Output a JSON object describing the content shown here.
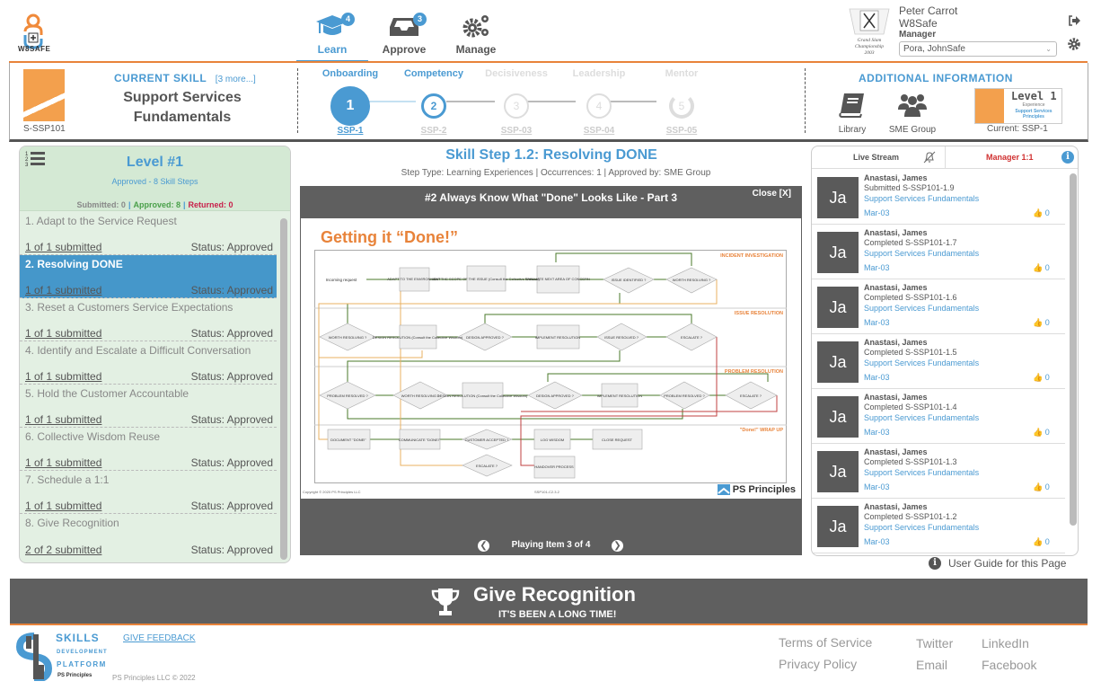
{
  "app": {
    "logo_text": "W8SAFE"
  },
  "nav": {
    "items": [
      {
        "label": "Learn",
        "badge": "4",
        "icon": "graduation-cap-icon",
        "active": true
      },
      {
        "label": "Approve",
        "badge": "3",
        "icon": "inbox-icon",
        "active": false
      },
      {
        "label": "Manage",
        "badge": null,
        "icon": "gears-icon",
        "active": false
      }
    ]
  },
  "user": {
    "name": "Peter Carrot",
    "org": "W8Safe",
    "role_label": "Manager",
    "selected_employee": "Pora, JohnSafe",
    "logo_caption": "Grand Slam Championship 2003"
  },
  "skill": {
    "heading": "CURRENT SKILL",
    "more_link": "[3 more...]",
    "name_line1": "Support Services",
    "name_line2": "Fundamentals",
    "code": "S-SSP101"
  },
  "progression": [
    {
      "title": "Onboarding",
      "number": "1",
      "code": "SSP-1",
      "state": "current"
    },
    {
      "title": "Competency",
      "number": "2",
      "code": "SSP-2",
      "state": "next"
    },
    {
      "title": "Decisiveness",
      "number": "3",
      "code": "SSP-03",
      "state": "locked"
    },
    {
      "title": "Leadership",
      "number": "4",
      "code": "SSP-04",
      "state": "locked"
    },
    {
      "title": "Mentor",
      "number": "5",
      "code": "SSP-05",
      "state": "locked"
    }
  ],
  "additional_info": {
    "title": "ADDITIONAL INFORMATION",
    "library_label": "Library",
    "sme_label": "SME Group",
    "level_card_title": "Level 1",
    "level_card_sub": "Experience",
    "level_card_skill": "Support Services Principles",
    "current_label": "Current:  SSP-1"
  },
  "level": {
    "title": "Level #1",
    "subtitle": "Approved  -  8  Skill  Steps",
    "submitted_label": "Submitted: 0",
    "approved_label": "Approved: 8",
    "returned_label": "Returned: 0",
    "steps": [
      {
        "name": "1. Adapt to the Service Request",
        "submitted": "1 of 1 submitted",
        "status": "Status: Approved",
        "selected": false
      },
      {
        "name": "2. Resolving DONE",
        "submitted": "1 of 1 submitted",
        "status": "Status: Approved",
        "selected": true
      },
      {
        "name": "3. Reset a Customers Service Expectations",
        "submitted": "1 of 1 submitted",
        "status": "Status: Approved",
        "selected": false
      },
      {
        "name": "4. Identify and Escalate a Difficult Conversation",
        "submitted": "1 of 1 submitted",
        "status": "Status: Approved",
        "selected": false
      },
      {
        "name": "5. Hold the Customer Accountable",
        "submitted": "1 of 1 submitted",
        "status": "Status: Approved",
        "selected": false
      },
      {
        "name": "6. Collective Wisdom Reuse",
        "submitted": "1 of 1 submitted",
        "status": "Status: Approved",
        "selected": false
      },
      {
        "name": "7. Schedule a 1:1",
        "submitted": "1 of 1 submitted",
        "status": "Status: Approved",
        "selected": false
      },
      {
        "name": "8. Give Recognition",
        "submitted": "2 of 2 submitted",
        "status": "Status: Approved",
        "selected": false
      }
    ]
  },
  "step_detail": {
    "title": "Skill Step 1.2: Resolving DONE",
    "meta": "Step Type:  Learning Experiences  |  Occurrences:  1  |  Approved by:   SME  Group",
    "player_title": "#2  Always  Know  What  \"Done\"  Looks  Like  -  Part  3",
    "close_label": "Close  [X]",
    "slide_title": "Getting it “Done!”",
    "slide_copyright": "Copyright © 2020 PS Principles LLC",
    "slide_code": "SSP101-C2.3.2",
    "slide_brand": "PS Principles",
    "playing_label": "Playing  Item  3  of  4",
    "flow": {
      "lanes": [
        "INCIDENT INVESTIGATION",
        "ISSUE RESOLUTION",
        "PROBLEM RESOLUTION",
        "\"Done!\" WRAP UP"
      ],
      "start_label": "Incoming request",
      "nodes": {
        "adapt": "ADAPT TO THE ENVIRONMENT",
        "map": "MAP THE SCOPE OF THE ISSUE (Consult the Collective Wisdom)",
        "evaluate": "EVALUATE NEXT AREA OF CONCERN",
        "issue_identified": "ISSUE IDENTIFIED ?",
        "worth_resolving": "WORTH RESOLVING ?",
        "design_resolution": "DESIGN RESOLUTION (Consult the Collective Wisdom)",
        "design_approved": "DESIGN APPROVED ?",
        "implement": "IMPLEMENT RESOLUTION",
        "issue_resolved": "ISSUE RESOLVED ?",
        "escalate": "ESCALATE ?",
        "problem_resolved": "PROBLEM RESOLVED ?",
        "document": "DOCUMENT \"DONE!\"",
        "communicate": "COMMUNICATE \"DONE!\"",
        "customer_accepted": "CUSTOMER ACCEPTED ?",
        "log_wisdom": "LOG WISDOM",
        "close_request": "CLOSE REQUEST",
        "handover": "HANDOVER PROCESS"
      }
    }
  },
  "stream": {
    "tab_live": "Live Stream",
    "tab_manager": "Manager 1:1",
    "items": [
      {
        "initials": "Ja",
        "name": "Anastasi,  James",
        "action": "Submitted  S-SSP101-1.9",
        "skill": "Support  Services  Fundamentals",
        "date": "Mar-03",
        "likes": "0"
      },
      {
        "initials": "Ja",
        "name": "Anastasi,  James",
        "action": "Completed  S-SSP101-1.7",
        "skill": "Support  Services  Fundamentals",
        "date": "Mar-03",
        "likes": "0"
      },
      {
        "initials": "Ja",
        "name": "Anastasi,  James",
        "action": "Completed  S-SSP101-1.6",
        "skill": "Support  Services  Fundamentals",
        "date": "Mar-03",
        "likes": "0"
      },
      {
        "initials": "Ja",
        "name": "Anastasi,  James",
        "action": "Completed  S-SSP101-1.5",
        "skill": "Support  Services  Fundamentals",
        "date": "Mar-03",
        "likes": "0"
      },
      {
        "initials": "Ja",
        "name": "Anastasi,  James",
        "action": "Completed  S-SSP101-1.4",
        "skill": "Support  Services  Fundamentals",
        "date": "Mar-03",
        "likes": "0"
      },
      {
        "initials": "Ja",
        "name": "Anastasi,  James",
        "action": "Completed  S-SSP101-1.3",
        "skill": "Support  Services  Fundamentals",
        "date": "Mar-03",
        "likes": "0"
      },
      {
        "initials": "Ja",
        "name": "Anastasi,  James",
        "action": "Completed  S-SSP101-1.2",
        "skill": "Support  Services  Fundamentals",
        "date": "Mar-03",
        "likes": "0"
      }
    ],
    "user_guide": "User  Guide  for  this  Page"
  },
  "banner": {
    "title": "Give Recognition",
    "subtitle": "IT'S BEEN A LONG TIME!"
  },
  "footer": {
    "brand_line1": "SKILLS",
    "brand_line2": "DEVELOPMENT",
    "brand_line3": "PLATFORM",
    "brand_line4": "PS Principles",
    "feedback": "GIVE FEEDBACK",
    "copyright": "PS Principles LLC © 2022",
    "links": {
      "terms": "Terms of Service",
      "privacy": "Privacy Policy",
      "twitter": "Twitter",
      "email": "Email",
      "linkedin": "LinkedIn",
      "facebook": "Facebook"
    }
  },
  "colors": {
    "accent": "#4a9ad2",
    "brand_orange": "#e8833a",
    "approved": "#4aa04a",
    "returned": "#c8204a",
    "manager_tab": "#d03030"
  }
}
